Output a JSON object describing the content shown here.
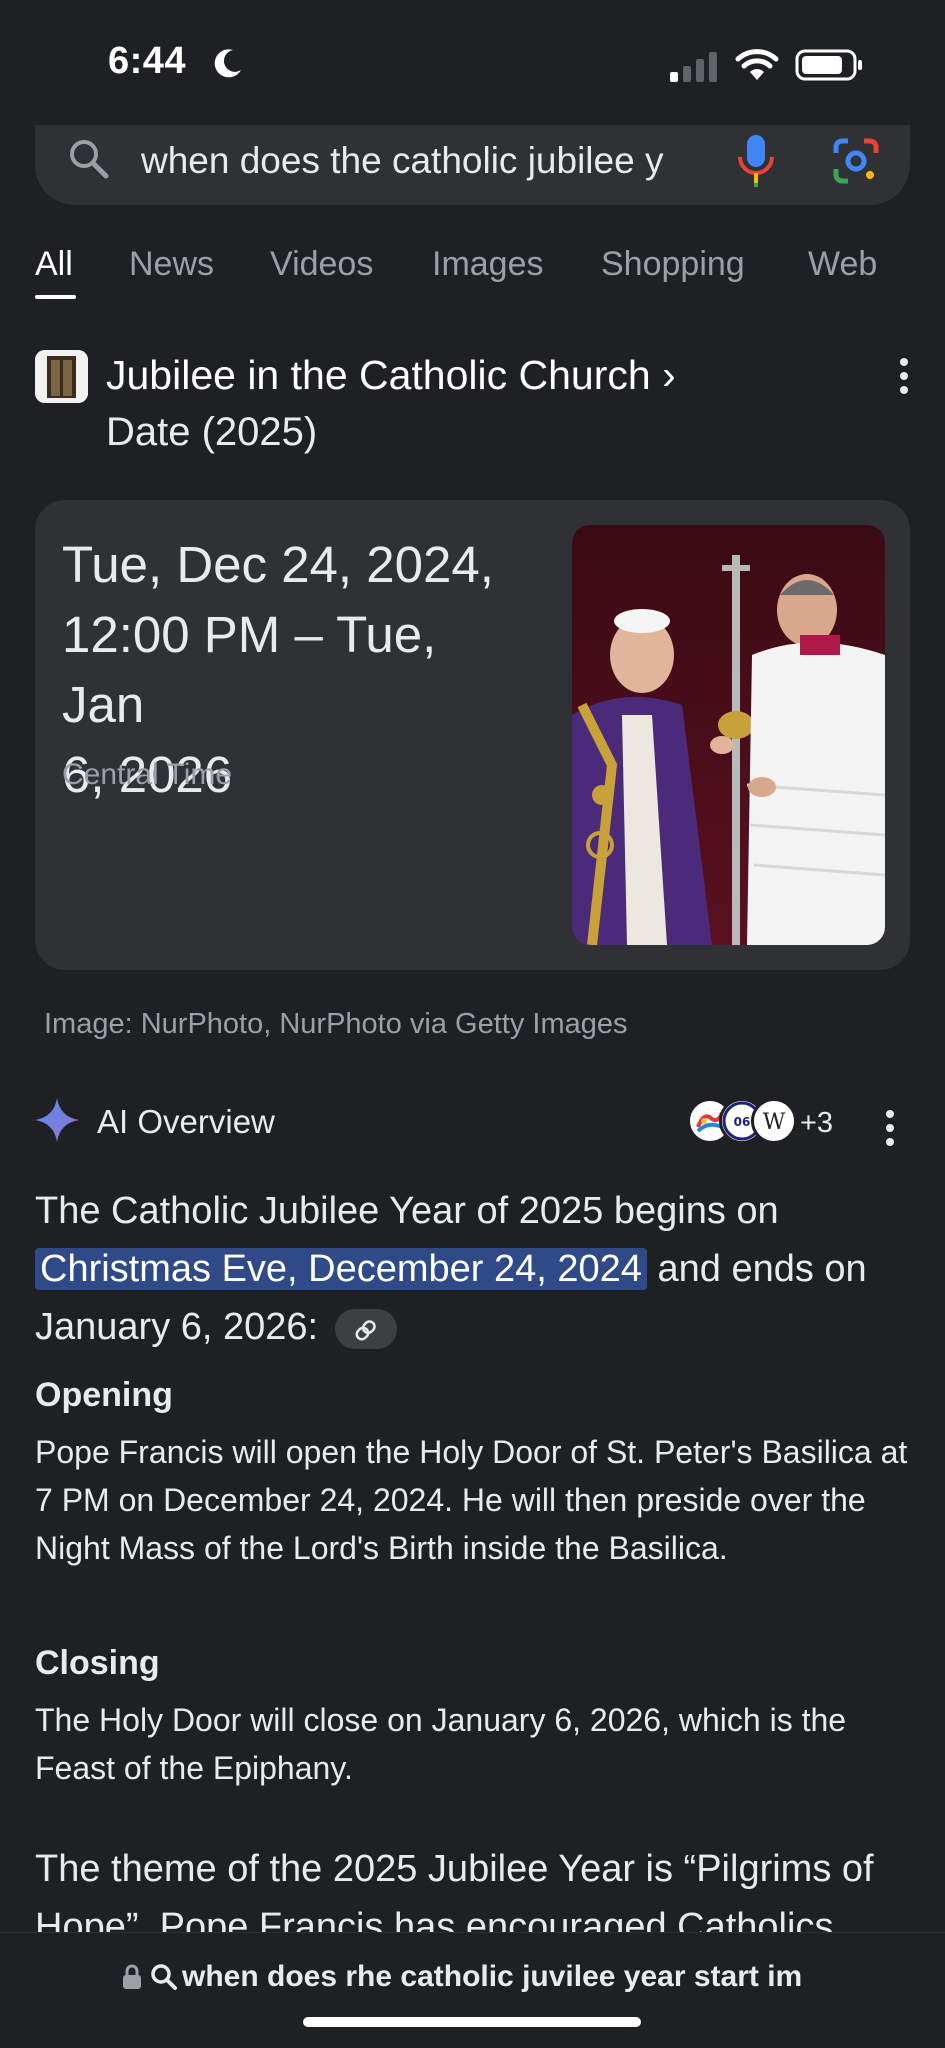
{
  "status": {
    "time": "6:44"
  },
  "search": {
    "query": "when does the catholic jubilee y"
  },
  "tabs": [
    "All",
    "News",
    "Videos",
    "Images",
    "Shopping",
    "Web"
  ],
  "entity": {
    "title": "Jubilee in the Catholic Church ›",
    "subtitle": "Date (2025)"
  },
  "date_card": {
    "date_line1": "Tue, Dec 24, 2024,",
    "date_line2": "12:00 PM – Tue, Jan",
    "date_line3": "6, 2026",
    "timezone": "Central Time"
  },
  "image_credit": "Image: NurPhoto, NurPhoto via Getty Images",
  "ai_overview": {
    "title": "AI Overview",
    "source_count": "+3",
    "intro_before": "The Catholic Jubilee Year of 2025 begins on",
    "intro_highlight": "Christmas Eve, December 24, 2024",
    "intro_after": " and ends on January 6, 2026:",
    "sections": [
      {
        "heading": "Opening",
        "body": "Pope Francis will open the Holy Door of St. Peter's Basilica at 7 PM on December 24, 2024. He will then preside over the Night Mass of the Lord's Birth inside the Basilica."
      },
      {
        "heading": "Closing",
        "body": "The Holy Door will close on January 6, 2026, which is the Feast of the Epiphany."
      }
    ],
    "theme_text": "The theme of the 2025 Jubilee Year is “Pilgrims of Hope”. Pope Francis has encouraged Catholics"
  },
  "url_bar": {
    "text": "when does rhe catholic juvilee year start im"
  },
  "colors": {
    "background": "#1f2023",
    "card": "#303134",
    "highlight": "#2f4a86",
    "secondary_text": "#9aa0a6"
  }
}
